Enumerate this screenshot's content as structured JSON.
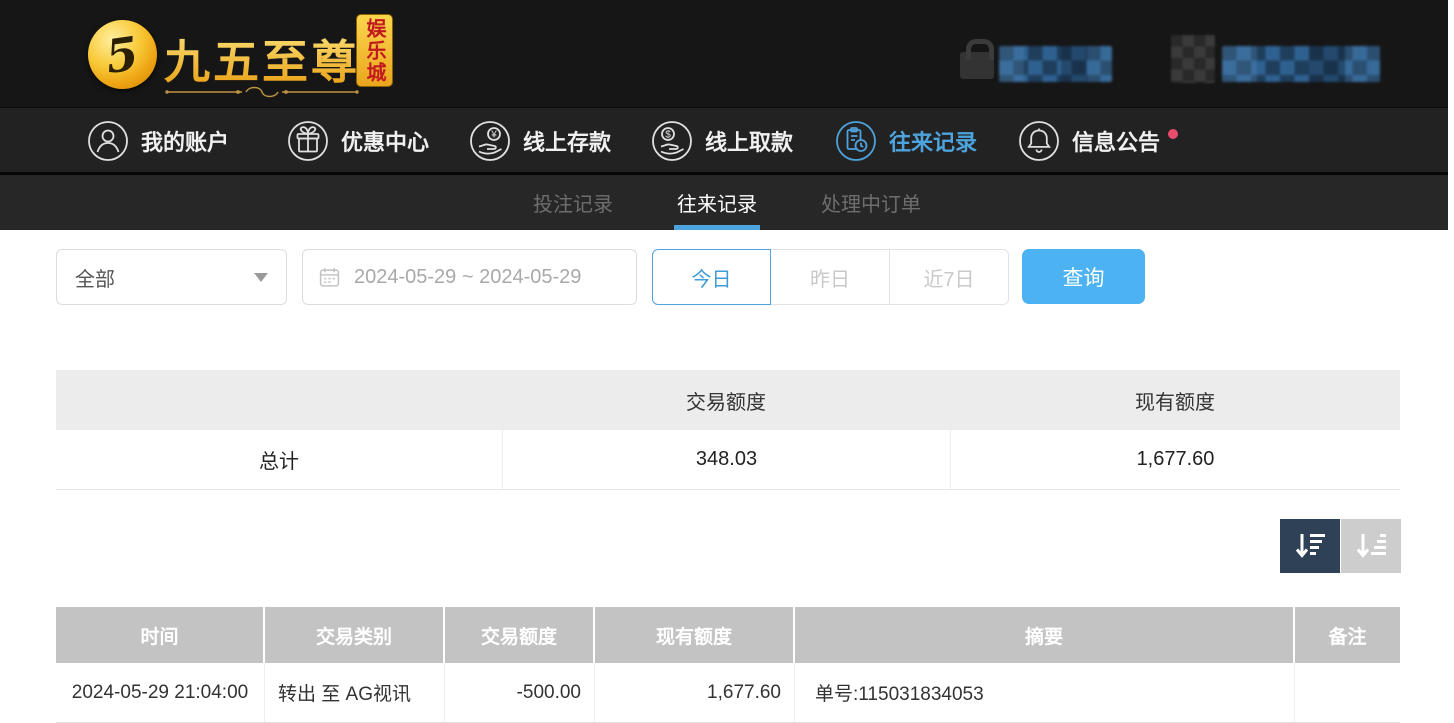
{
  "brand": {
    "logo_glyph": "5",
    "name": "九五至尊",
    "badge": "娱乐城"
  },
  "user_area": {
    "blurred": true
  },
  "nav": {
    "items": [
      {
        "label": "我的账户",
        "icon": "user-icon",
        "active": false
      },
      {
        "label": "优惠中心",
        "icon": "gift-icon",
        "active": false
      },
      {
        "label": "线上存款",
        "icon": "deposit-icon",
        "active": false
      },
      {
        "label": "线上取款",
        "icon": "withdraw-icon",
        "active": false
      },
      {
        "label": "往来记录",
        "icon": "records-icon",
        "active": true
      },
      {
        "label": "信息公告",
        "icon": "bell-icon",
        "active": false,
        "has_notification_dot": true
      }
    ]
  },
  "tabs": {
    "items": [
      {
        "label": "投注记录",
        "active": false
      },
      {
        "label": "往来记录",
        "active": true
      },
      {
        "label": "处理中订单",
        "active": false
      }
    ]
  },
  "filters": {
    "type_select": {
      "value": "全部"
    },
    "date_range": {
      "value": "2024-05-29 ~ 2024-05-29"
    },
    "quick_ranges": [
      {
        "label": "今日",
        "active": true
      },
      {
        "label": "昨日",
        "active": false
      },
      {
        "label": "近7日",
        "active": false
      }
    ],
    "search_button": "查询"
  },
  "summary_table": {
    "columns": [
      "",
      "交易额度",
      "现有额度"
    ],
    "total_row": {
      "label": "总计",
      "transaction_amount": "348.03",
      "current_balance": "1,677.60"
    }
  },
  "records_table": {
    "columns": [
      "时间",
      "交易类别",
      "交易额度",
      "现有额度",
      "摘要",
      "备注"
    ],
    "rows": [
      {
        "time": "2024-05-29 21:04:00",
        "type": "转出 至 AG视讯",
        "amount": "-500.00",
        "balance": "1,677.60",
        "summary": "单号:115031834053",
        "remark": ""
      }
    ]
  },
  "colors": {
    "accent_blue": "#4da3dd",
    "query_button_blue": "#4db2f2",
    "notification_dot": "#ea4c6d",
    "sort_active_bg": "#2e4156",
    "sort_inactive_bg": "#cdcdcd",
    "records_header_bg": "#c3c3c3",
    "summary_header_bg": "#ececec"
  }
}
